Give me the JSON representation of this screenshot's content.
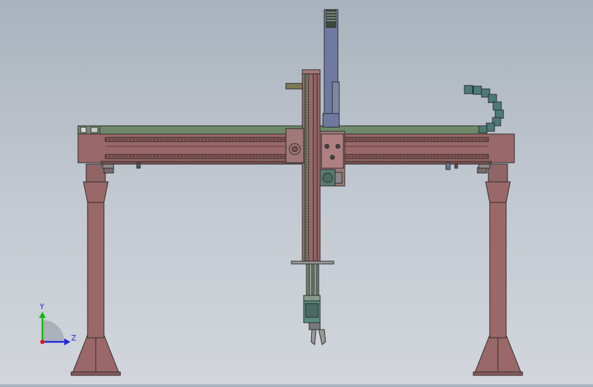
{
  "triad": {
    "y_label": "Y",
    "z_label": "Z",
    "y_color": "#14b814",
    "z_color": "#1c2ad8",
    "x_color": "#d81c1c"
  },
  "colors": {
    "frame": "#9a6868",
    "frame_dark": "#6a4040",
    "rail": "#6f8a6a",
    "steel": "#6f78a0",
    "column": "#8f6a6a",
    "edge": "#2a2a2a",
    "accent": "#4d7a76",
    "plate": "#a07878"
  }
}
